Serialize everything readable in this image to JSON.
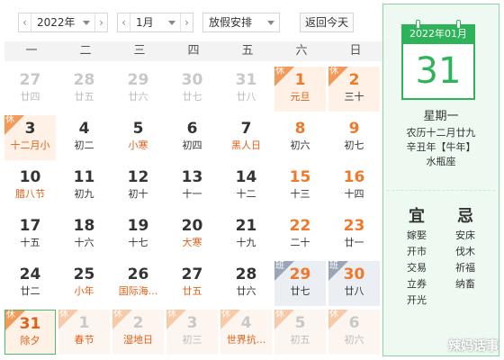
{
  "toolbar": {
    "year": "2022年",
    "month": "1月",
    "holiday": "放假安排",
    "today_button": "返回今天"
  },
  "weekdays": [
    "一",
    "二",
    "三",
    "四",
    "五",
    "六",
    "日"
  ],
  "tags": {
    "rest": "休",
    "work": "班"
  },
  "weeks": [
    [
      {
        "d": "27",
        "s": "廿四",
        "other": true
      },
      {
        "d": "28",
        "s": "廿五",
        "other": true
      },
      {
        "d": "29",
        "s": "廿六",
        "other": true
      },
      {
        "d": "30",
        "s": "廿七",
        "other": true
      },
      {
        "d": "31",
        "s": "廿八",
        "other": true
      },
      {
        "d": "1",
        "s": "元旦",
        "weekend": true,
        "tag": "rest",
        "festival": true
      },
      {
        "d": "2",
        "s": "三十",
        "weekend": true,
        "tag": "rest"
      }
    ],
    [
      {
        "d": "3",
        "s": "十二月小",
        "tag": "rest",
        "festival": true
      },
      {
        "d": "4",
        "s": "初二"
      },
      {
        "d": "5",
        "s": "小寒",
        "festival": true
      },
      {
        "d": "6",
        "s": "初四"
      },
      {
        "d": "7",
        "s": "黑人日",
        "festival": true
      },
      {
        "d": "8",
        "s": "初六",
        "weekend": true
      },
      {
        "d": "9",
        "s": "初七",
        "weekend": true
      }
    ],
    [
      {
        "d": "10",
        "s": "腊八节",
        "festival": true
      },
      {
        "d": "11",
        "s": "初九"
      },
      {
        "d": "12",
        "s": "初十"
      },
      {
        "d": "13",
        "s": "十一"
      },
      {
        "d": "14",
        "s": "十二"
      },
      {
        "d": "15",
        "s": "十三",
        "weekend": true
      },
      {
        "d": "16",
        "s": "十四",
        "weekend": true
      }
    ],
    [
      {
        "d": "17",
        "s": "十五"
      },
      {
        "d": "18",
        "s": "十六"
      },
      {
        "d": "19",
        "s": "十七"
      },
      {
        "d": "20",
        "s": "大寒",
        "festival": true
      },
      {
        "d": "21",
        "s": "十九"
      },
      {
        "d": "22",
        "s": "二十",
        "weekend": true
      },
      {
        "d": "23",
        "s": "廿一",
        "weekend": true
      }
    ],
    [
      {
        "d": "24",
        "s": "廿二"
      },
      {
        "d": "25",
        "s": "小年",
        "festival": true
      },
      {
        "d": "26",
        "s": "国际海...",
        "festival": true
      },
      {
        "d": "27",
        "s": "廿五",
        "festival": true
      },
      {
        "d": "28",
        "s": "廿六"
      },
      {
        "d": "29",
        "s": "廿七",
        "weekend": true,
        "tag": "work"
      },
      {
        "d": "30",
        "s": "廿八",
        "weekend": true,
        "tag": "work"
      }
    ],
    [
      {
        "d": "31",
        "s": "除夕",
        "tag": "rest",
        "today": true,
        "festival": true
      },
      {
        "d": "1",
        "s": "春节",
        "other": true,
        "tag": "rest",
        "festival": true
      },
      {
        "d": "2",
        "s": "湿地日",
        "other": true,
        "tag": "rest",
        "festival": true
      },
      {
        "d": "3",
        "s": "初三",
        "other": true,
        "tag": "rest"
      },
      {
        "d": "4",
        "s": "世界抗...",
        "other": true,
        "tag": "rest",
        "festival": true
      },
      {
        "d": "5",
        "s": "初五",
        "other": true,
        "tag": "rest"
      },
      {
        "d": "6",
        "s": "初六",
        "other": true,
        "tag": "rest"
      }
    ]
  ],
  "side": {
    "header": "2022年01月",
    "day": "31",
    "weekday": "星期一",
    "lunar": "农历十二月廿九",
    "ganzhi": "辛丑年【牛年】",
    "zodiac": "水瓶座",
    "yi_label": "宜",
    "ji_label": "忌",
    "yi": [
      "嫁娶",
      "开市",
      "交易",
      "立券",
      "开光"
    ],
    "ji": [
      "安床",
      "伐木",
      "祈福",
      "纳畜"
    ]
  },
  "watermark": "辣妈话事"
}
